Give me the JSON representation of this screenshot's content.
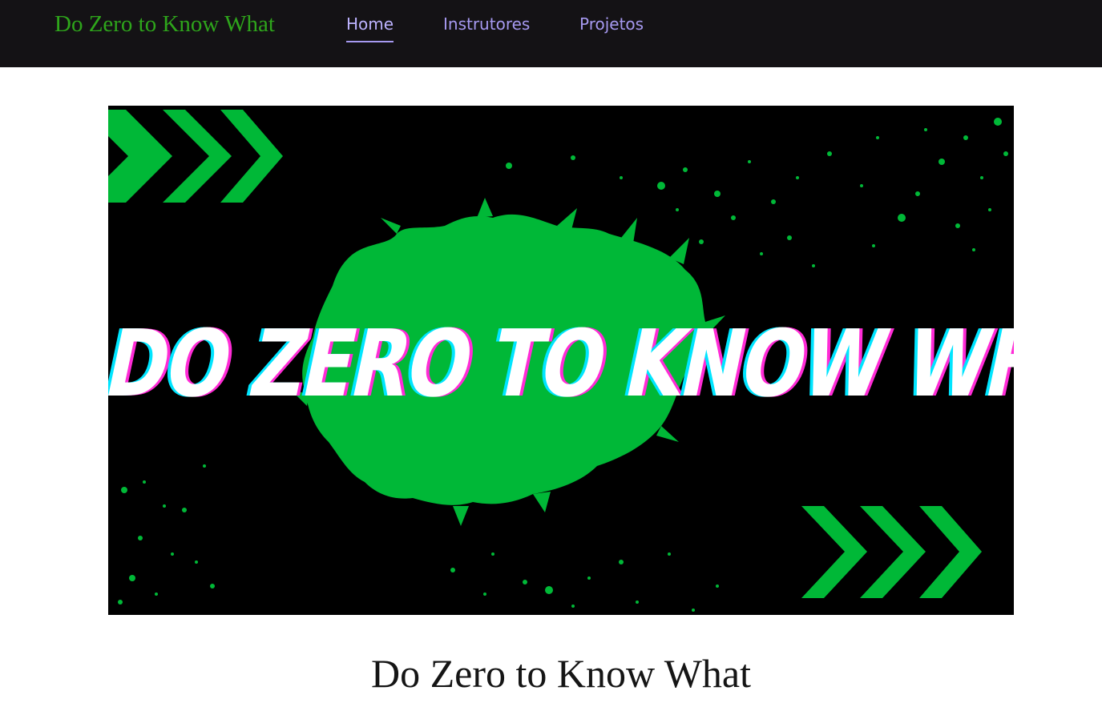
{
  "header": {
    "brand": "Do Zero to Know What",
    "nav": [
      {
        "label": "Home",
        "active": true
      },
      {
        "label": "Instrutores",
        "active": false
      },
      {
        "label": "Projetos",
        "active": false
      }
    ]
  },
  "hero": {
    "banner_text": "DO ZERO TO KNOW WHAT",
    "colors": {
      "background": "#000000",
      "accent": "#00b837"
    }
  },
  "main": {
    "title": "Do Zero to Know What"
  },
  "colors": {
    "nav_background": "#141215",
    "brand": "#2ea51b",
    "nav_link": "#a699f0"
  }
}
